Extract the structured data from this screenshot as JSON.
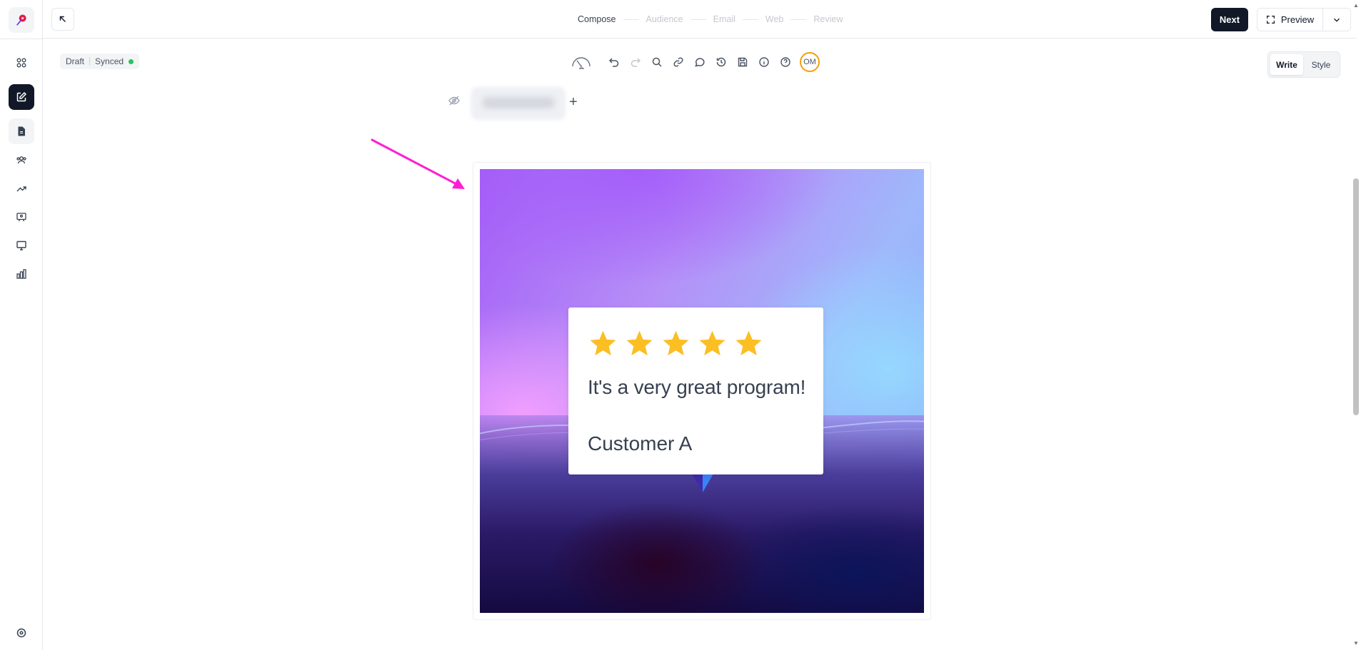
{
  "topbar": {
    "steps": [
      {
        "label": "Compose",
        "current": true
      },
      {
        "label": "Audience",
        "current": false
      },
      {
        "label": "Email",
        "current": false
      },
      {
        "label": "Web",
        "current": false
      },
      {
        "label": "Review",
        "current": false
      }
    ],
    "next_label": "Next",
    "preview_label": "Preview"
  },
  "status": {
    "draft_label": "Draft",
    "synced_label": "Synced",
    "synced_color": "#22c55e"
  },
  "toolbar": {
    "icons": [
      "readability-gauge-icon",
      "undo-icon",
      "redo-icon",
      "search-icon",
      "link-icon",
      "comment-icon",
      "history-icon",
      "save-icon",
      "info-icon",
      "help-icon"
    ],
    "avatar_initials": "OM",
    "avatar_ring_color": "#f59e0b"
  },
  "mode": {
    "write_label": "Write",
    "style_label": "Style",
    "selected": "Write"
  },
  "sidebar": {
    "items": [
      "apps-icon",
      "edit-icon",
      "document-icon",
      "audience-icon",
      "trending-icon",
      "presentation-icon",
      "monitor-icon",
      "analytics-icon"
    ],
    "bottom": "settings-icon"
  },
  "review": {
    "stars": 5,
    "star_color": "#fbbf24",
    "text": "It's a very great program!",
    "author": "Customer A"
  },
  "annotation": {
    "arrow_color": "#ff1fd1"
  }
}
